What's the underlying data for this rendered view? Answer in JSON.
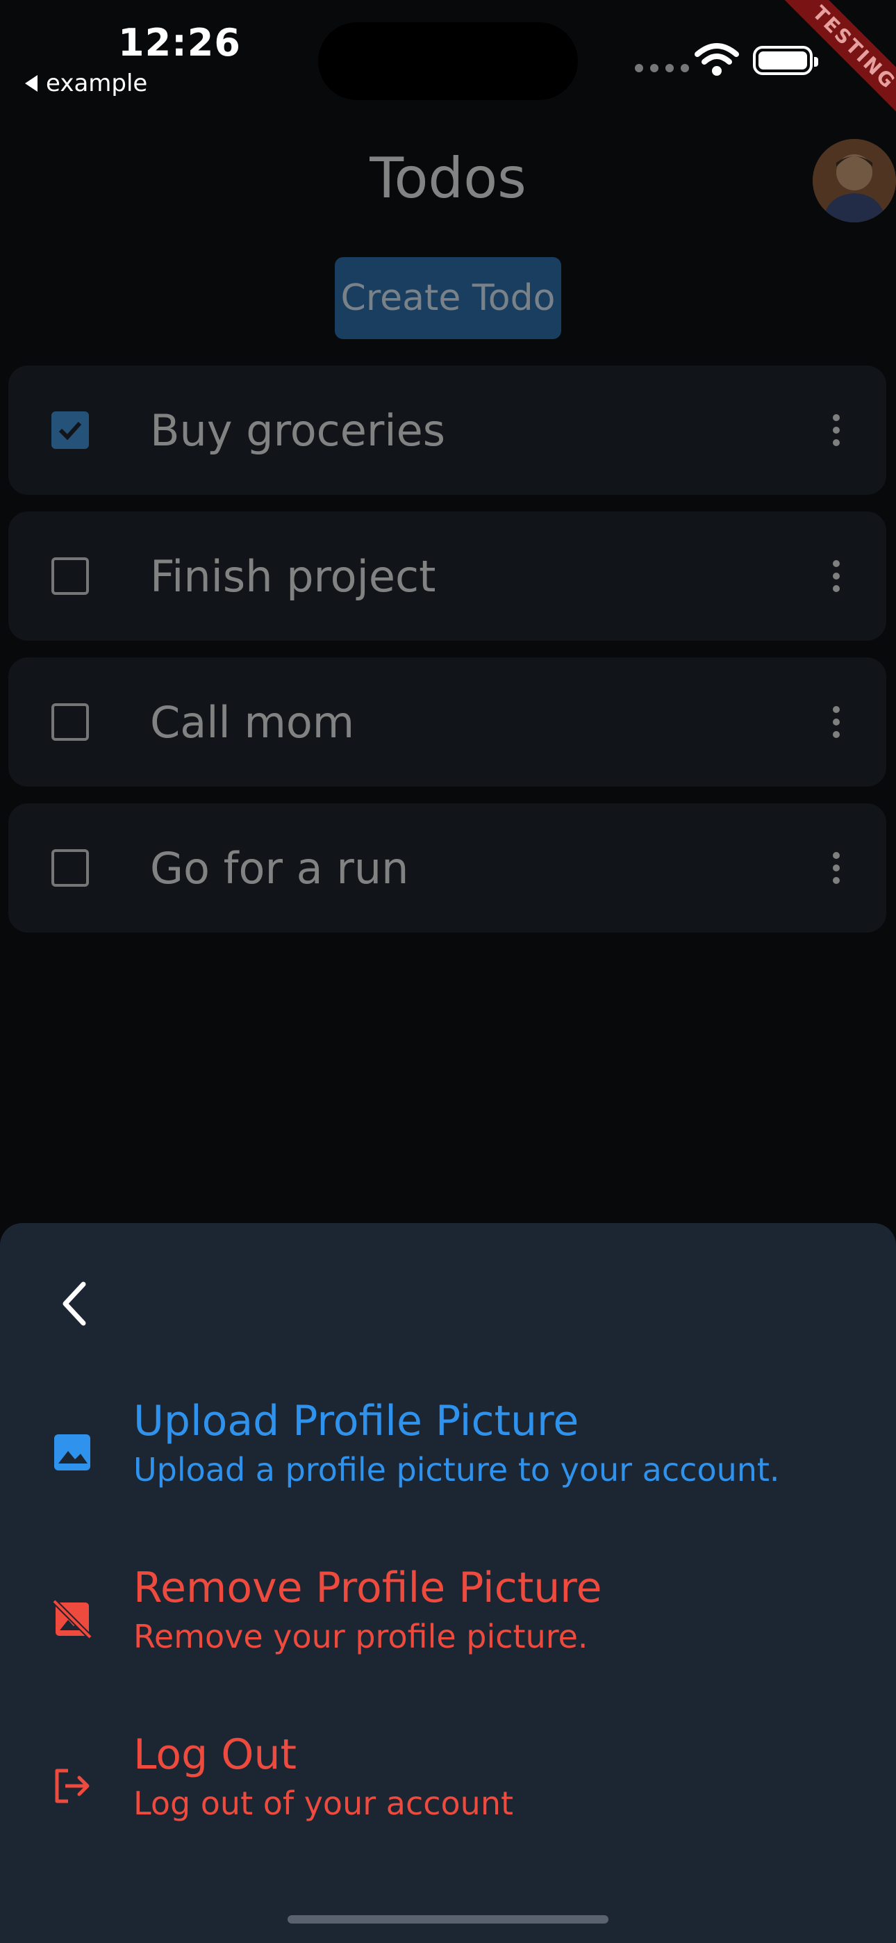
{
  "status_bar": {
    "time": "12:26",
    "back_app": "example",
    "badge": "TESTING"
  },
  "header": {
    "title": "Todos",
    "create_button": "Create Todo"
  },
  "todos": [
    {
      "label": "Buy groceries",
      "done": true
    },
    {
      "label": "Finish project",
      "done": false
    },
    {
      "label": "Call mom",
      "done": false
    },
    {
      "label": "Go for a run",
      "done": false
    }
  ],
  "sheet": {
    "options": [
      {
        "title": "Upload Profile Picture",
        "subtitle": "Upload a profile picture to your account.",
        "icon": "image-icon",
        "color": "#2f93ee"
      },
      {
        "title": "Remove Profile Picture",
        "subtitle": "Remove your profile picture.",
        "icon": "hide-image-icon",
        "color": "#ee4a3e"
      },
      {
        "title": "Log Out",
        "subtitle": "Log out of your account",
        "icon": "logout-icon",
        "color": "#ee4a3e"
      }
    ]
  },
  "colors": {
    "background": "#08090b",
    "card": "#1a1e26",
    "sheet": "#1c2532",
    "accent": "#2f93ee",
    "danger": "#ee4a3e"
  }
}
